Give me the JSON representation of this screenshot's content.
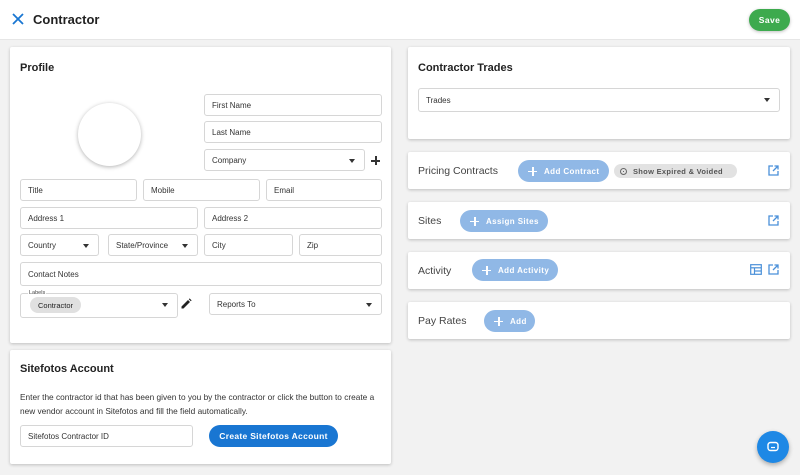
{
  "header": {
    "title": "Contractor",
    "save_label": "Save"
  },
  "profile": {
    "heading": "Profile",
    "first_name_placeholder": "First Name",
    "last_name_placeholder": "Last Name",
    "company_label": "Company",
    "title_placeholder": "Title",
    "mobile_placeholder": "Mobile",
    "email_placeholder": "Email",
    "address1_placeholder": "Address 1",
    "address2_placeholder": "Address 2",
    "country_label": "Country",
    "state_label": "State/Province",
    "city_placeholder": "City",
    "zip_placeholder": "Zip",
    "contact_notes_placeholder": "Contact Notes",
    "labels_caption": "Labels",
    "labels_chip": "Contractor",
    "reports_to_label": "Reports To"
  },
  "sitefotos": {
    "heading": "Sitefotos Account",
    "description": "Enter the contractor id that has been given to you by the contractor or click the button to create a new vendor account in Sitefotos and fill the field automatically.",
    "contractor_id_placeholder": "Sitefotos Contractor ID",
    "create_button": "Create Sitefotos Account"
  },
  "trades": {
    "heading": "Contractor Trades",
    "trades_label": "Trades"
  },
  "pricing_contracts": {
    "heading": "Pricing Contracts",
    "add_button": "Add Contract",
    "show_expired_chip": "Show Expired & Voided"
  },
  "sites": {
    "heading": "Sites",
    "assign_button": "Assign Sites"
  },
  "activity": {
    "heading": "Activity",
    "add_button": "Add Activity"
  },
  "pay_rates": {
    "heading": "Pay Rates",
    "add_button": "Add"
  },
  "colors": {
    "save_green": "#3daa4e",
    "primary_blue": "#1976d2",
    "pill_blue": "#90b8e6",
    "icon_blue": "#4a90d9",
    "background": "#f2f2f2"
  },
  "icons": {
    "close": "close-icon",
    "add_company": "plus-icon",
    "edit_labels": "pencil-icon",
    "open_external": "open-in-new-icon",
    "activity_table": "table-view-icon",
    "chat": "chat-icon"
  }
}
